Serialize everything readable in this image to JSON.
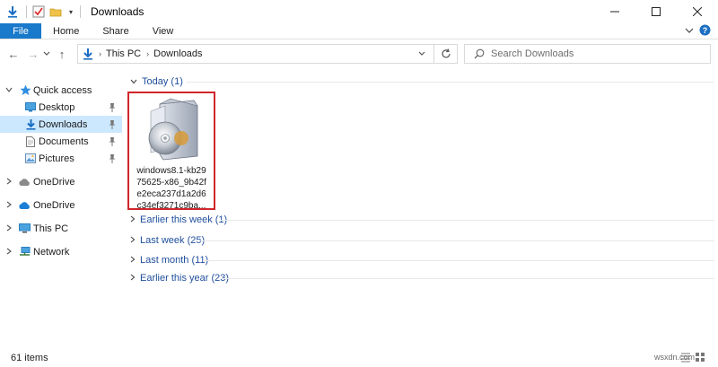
{
  "window": {
    "title": "Downloads",
    "minimize": "—",
    "maximize": "☐",
    "close": "✕"
  },
  "ribbon": {
    "tabs": [
      "File",
      "Home",
      "Share",
      "View"
    ]
  },
  "address": {
    "back": "←",
    "forward": "→",
    "recent": "⌄",
    "up": "↑",
    "crumbs": [
      "This PC",
      "Downloads"
    ],
    "search_placeholder": "Search Downloads"
  },
  "nav": {
    "items": [
      {
        "label": "Quick access",
        "icon": "star-icon"
      },
      {
        "label": "Desktop",
        "icon": "desktop-folder-icon"
      },
      {
        "label": "Downloads",
        "icon": "downloads-icon"
      },
      {
        "label": "Documents",
        "icon": "documents-icon"
      },
      {
        "label": "Pictures",
        "icon": "pictures-icon"
      },
      {
        "label": "OneDrive",
        "icon": "onedrive-icon"
      },
      {
        "label": "OneDrive",
        "icon": "onedrive-icon"
      },
      {
        "label": "This PC",
        "icon": "computer-icon"
      },
      {
        "label": "Network",
        "icon": "network-icon"
      }
    ]
  },
  "groups": [
    {
      "label": "Today (1)",
      "expanded": true
    },
    {
      "label": "Earlier this week (1)",
      "expanded": false
    },
    {
      "label": "Last week (25)",
      "expanded": false
    },
    {
      "label": "Last month (11)",
      "expanded": false
    },
    {
      "label": "Earlier this year (23)",
      "expanded": false
    }
  ],
  "file": {
    "name": "windows8.1-kb2975625-x86_9b42fe2eca237d1a2d6c34ef3271c9ba...",
    "name_lines": [
      "windows8.1-kb29",
      "75625-x86_9b42f",
      "e2eca237d1a2d6",
      "c34ef3271c9ba..."
    ],
    "icon": "installer-package-icon"
  },
  "status": {
    "count": "61 items",
    "watermark": "wsxdn.com"
  },
  "colors": {
    "file_tab": "#1979ca",
    "selected_nav": "#cce8ff",
    "highlight_border": "#d0262b",
    "group_text": "#1f4e9c"
  }
}
